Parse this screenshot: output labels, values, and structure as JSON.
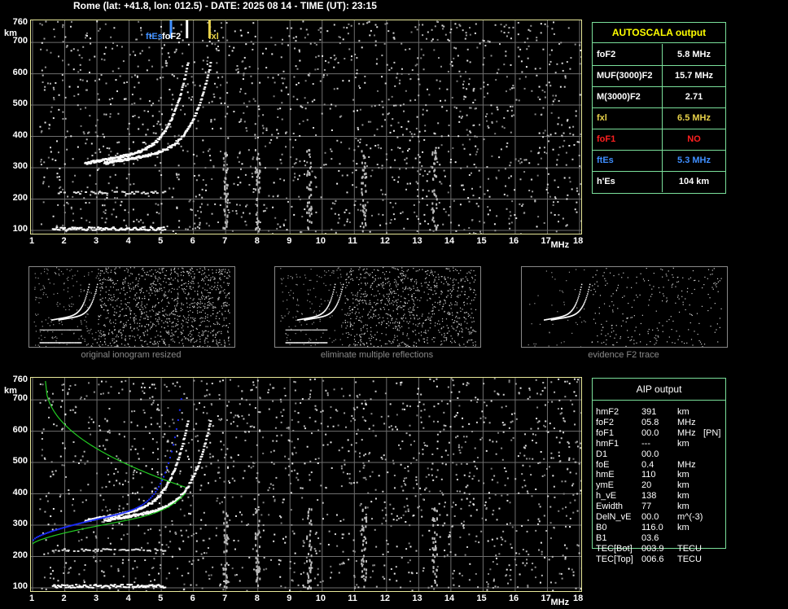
{
  "header": "Rome (lat: +41.8, lon: 012.5) - DATE: 2025 08 14 - TIME (UT): 23:15",
  "axes": {
    "x_ticks": [
      "1",
      "2",
      "3",
      "4",
      "5",
      "6",
      "7",
      "8",
      "9",
      "10",
      "11",
      "12",
      "13",
      "14",
      "15",
      "16",
      "17",
      "18"
    ],
    "y_ticks": [
      "760",
      "700",
      "600",
      "500",
      "400",
      "300",
      "200",
      "100"
    ],
    "x_unit": "MHz",
    "y_unit": "km"
  },
  "markers": {
    "ftEs": "ftEs",
    "foF2": "foF2",
    "fxl": "fxl"
  },
  "autoscala": {
    "title": "AUTOSCALA output",
    "rows": [
      {
        "key": "foF2",
        "value": "5.8 MHz",
        "color": "#ffffff"
      },
      {
        "key": "MUF(3000)F2",
        "value": "15.7 MHz",
        "color": "#ffffff"
      },
      {
        "key": "M(3000)F2",
        "value": "2.71",
        "color": "#ffffff"
      },
      {
        "key": "fxl",
        "value": "6.5 MHz",
        "color": "#e8d24a"
      },
      {
        "key": "foF1",
        "value": "NO",
        "color": "#ff2020"
      },
      {
        "key": "ftEs",
        "value": "5.3 MHz",
        "color": "#3f8fff"
      },
      {
        "key": "h'Es",
        "value": "104     km",
        "color": "#ffffff"
      }
    ]
  },
  "thumbs": {
    "cap1": "original ionogram resized",
    "cap2": "eliminate multiple reflections",
    "cap3": "evidence F2 trace"
  },
  "aip": {
    "title": "AIP output",
    "rows": [
      {
        "name": "hmF2",
        "val": "391",
        "unit": "km",
        "extra": ""
      },
      {
        "name": "foF2",
        "val": "05.8",
        "unit": "MHz",
        "extra": ""
      },
      {
        "name": "foF1",
        "val": "00.0",
        "unit": "MHz",
        "extra": "[PN]"
      },
      {
        "name": "hmF1",
        "val": "---",
        "unit": "km",
        "extra": ""
      },
      {
        "name": "D1",
        "val": "00.0",
        "unit": "",
        "extra": ""
      },
      {
        "name": "foE",
        "val": "0.4",
        "unit": "MHz",
        "extra": ""
      },
      {
        "name": "hmE",
        "val": "110",
        "unit": "km",
        "extra": ""
      },
      {
        "name": "ymE",
        "val": "20",
        "unit": "km",
        "extra": ""
      },
      {
        "name": "h_vE",
        "val": "138",
        "unit": "km",
        "extra": ""
      },
      {
        "name": "Ewidth",
        "val": "77",
        "unit": "km",
        "extra": ""
      },
      {
        "name": "DelN_vE",
        "val": "00.0",
        "unit": "m^(-3)",
        "extra": ""
      },
      {
        "name": "B0",
        "val": "116.0",
        "unit": "km",
        "extra": ""
      },
      {
        "name": "B1",
        "val": "03.6",
        "unit": "",
        "extra": ""
      },
      {
        "name": "TEC[Bot]",
        "val": "003.9",
        "unit": "TECU",
        "extra": ""
      },
      {
        "name": "TEC[Top]",
        "val": "006.6",
        "unit": "TECU",
        "extra": ""
      }
    ]
  },
  "colors": {
    "axis": "#e8e89a",
    "panel_border": "#7adf9a",
    "trace": "#ffffff",
    "model": "#22cc22",
    "fit": "#1a2cff"
  }
}
